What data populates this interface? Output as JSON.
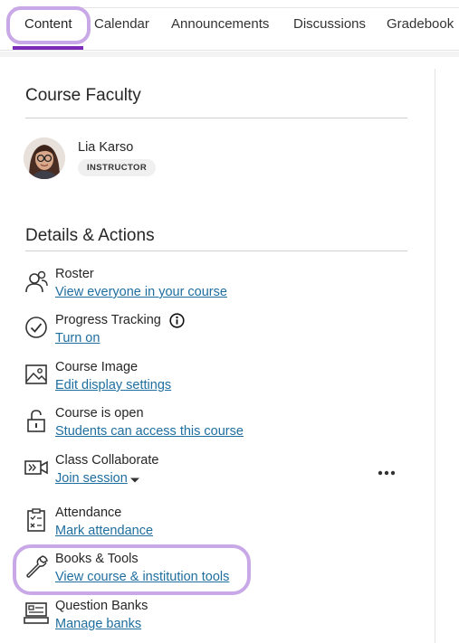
{
  "tabs": [
    {
      "label": "Content",
      "active": true
    },
    {
      "label": "Calendar"
    },
    {
      "label": "Announcements"
    },
    {
      "label": "Discussions"
    },
    {
      "label": "Gradebook"
    }
  ],
  "faculty": {
    "heading": "Course Faculty",
    "name": "Lia Karso",
    "role": "INSTRUCTOR"
  },
  "details": {
    "heading": "Details & Actions",
    "items": [
      {
        "title": "Roster",
        "link": "View everyone in your course",
        "icon": "roster-icon"
      },
      {
        "title": "Progress Tracking",
        "link": "Turn on",
        "icon": "progress-check-icon"
      },
      {
        "title": "Course Image",
        "link": "Edit display settings",
        "icon": "image-icon"
      },
      {
        "title": "Course is open",
        "link": "Students can access this course",
        "icon": "unlock-icon"
      },
      {
        "title": "Class Collaborate",
        "link": "Join session",
        "icon": "collaborate-icon"
      },
      {
        "title": "Attendance",
        "link": "Mark attendance",
        "icon": "clipboard-icon"
      },
      {
        "title": "Books & Tools",
        "link": "View course & institution tools",
        "icon": "wrench-icon"
      },
      {
        "title": "Question Banks",
        "link": "Manage banks",
        "icon": "question-bank-icon"
      }
    ]
  },
  "colors": {
    "accent": "#7b2bb7",
    "highlight_ring": "#c8a8e6",
    "link": "#1e6ea0"
  }
}
